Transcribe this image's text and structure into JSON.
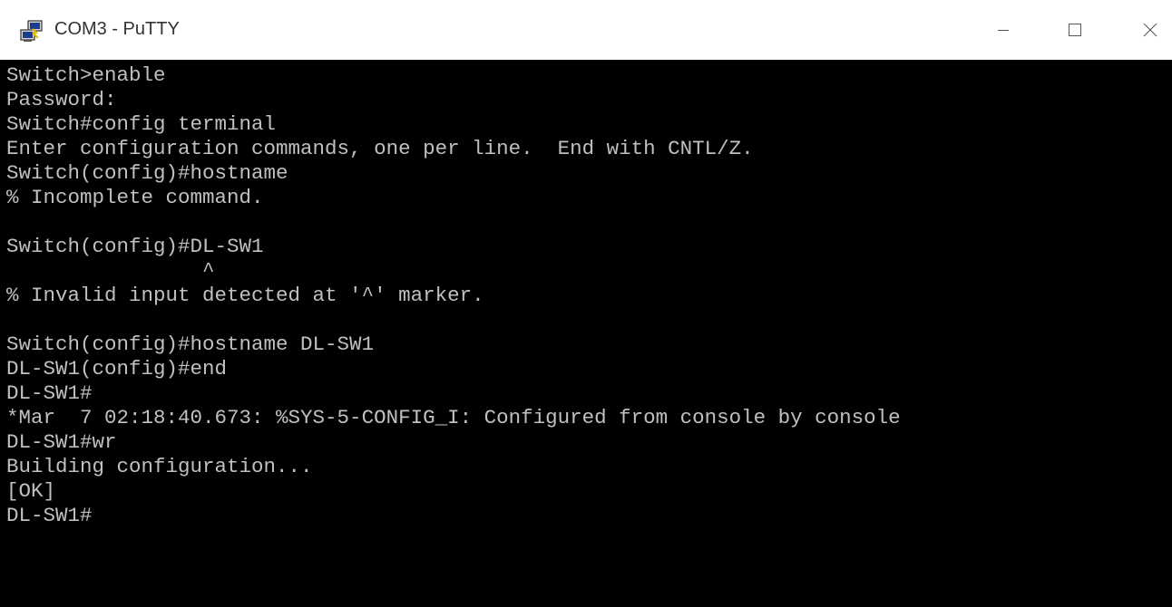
{
  "window": {
    "title": "COM3 - PuTTY",
    "icon": "putty-icon"
  },
  "controls": {
    "minimize_icon": "minimize-icon",
    "maximize_icon": "maximize-icon",
    "close_icon": "close-icon"
  },
  "colors": {
    "terminal_bg": "#000000",
    "terminal_fg": "#c0c0c0",
    "titlebar_bg": "#ffffff"
  },
  "terminal": {
    "lines": [
      "Switch>enable",
      "Password:",
      "Switch#config terminal",
      "Enter configuration commands, one per line.  End with CNTL/Z.",
      "Switch(config)#hostname",
      "% Incomplete command.",
      "",
      "Switch(config)#DL-SW1",
      "                ^",
      "% Invalid input detected at '^' marker.",
      "",
      "Switch(config)#hostname DL-SW1",
      "DL-SW1(config)#end",
      "DL-SW1#",
      "*Mar  7 02:18:40.673: %SYS-5-CONFIG_I: Configured from console by console",
      "DL-SW1#wr",
      "Building configuration...",
      "[OK]",
      "DL-SW1#"
    ]
  }
}
